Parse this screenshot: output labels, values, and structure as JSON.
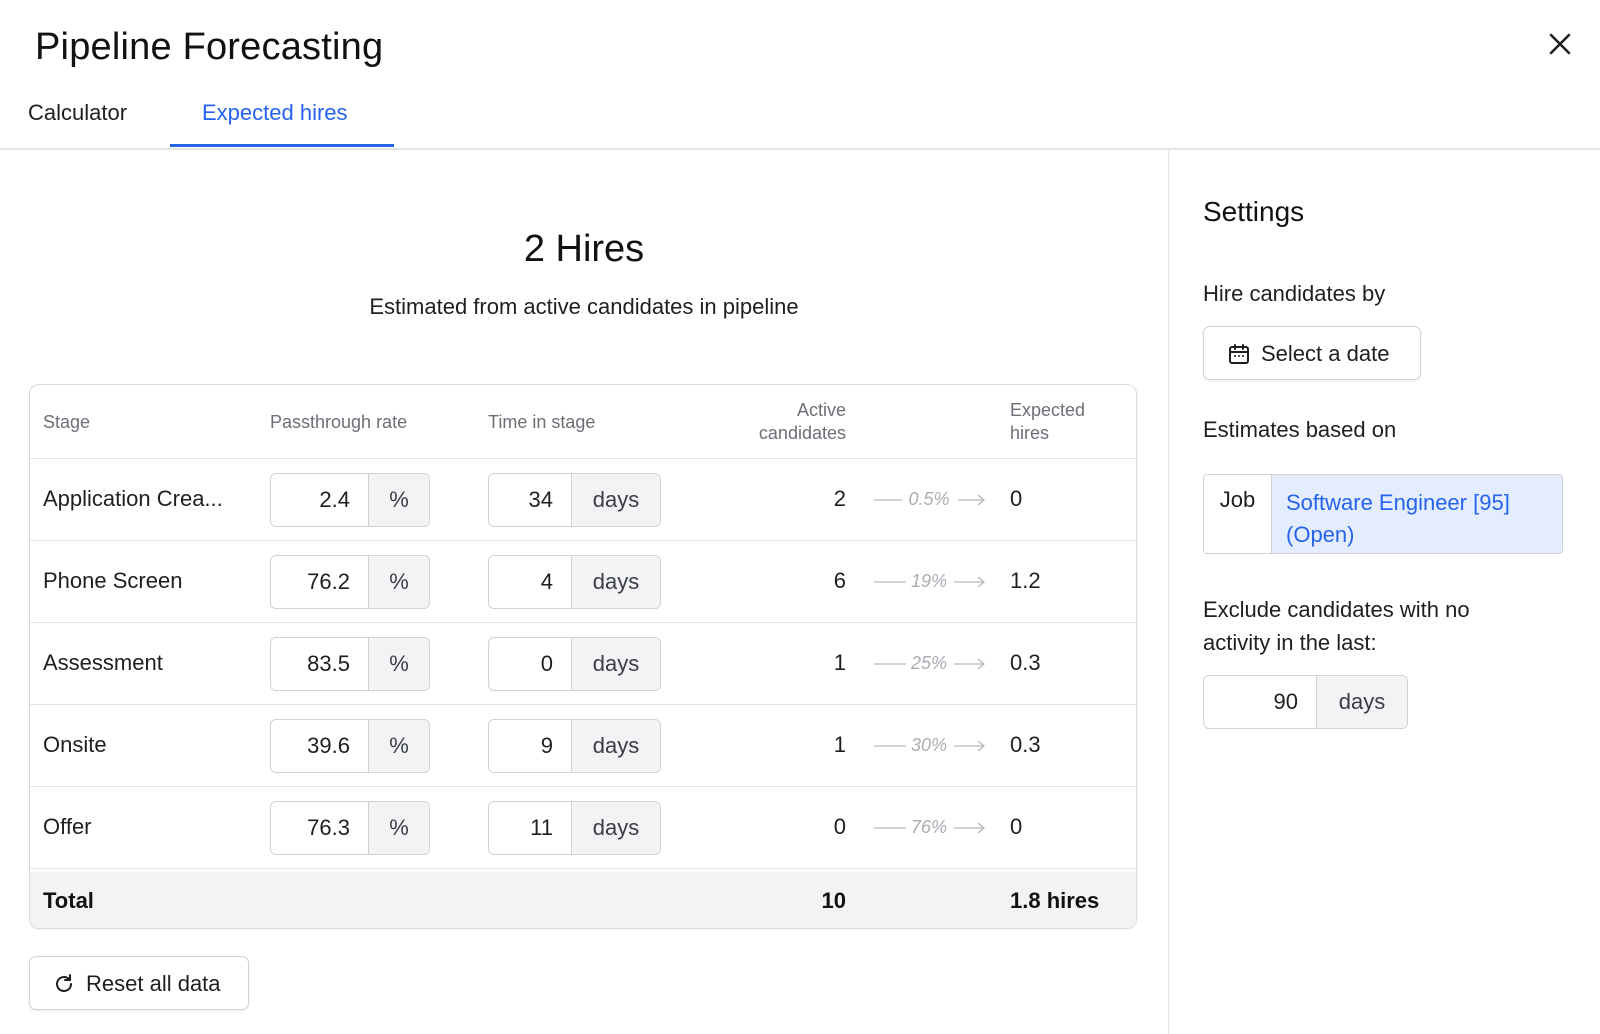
{
  "header": {
    "title": "Pipeline Forecasting",
    "tabs": [
      {
        "label": "Calculator",
        "active": false
      },
      {
        "label": "Expected hires",
        "active": true
      }
    ],
    "close_icon": "close-icon"
  },
  "summary": {
    "hires": "2 Hires",
    "subtitle": "Estimated from active candidates in pipeline"
  },
  "table": {
    "columns": {
      "stage": "Stage",
      "passthrough": "Passthrough rate",
      "time": "Time in stage",
      "active_line1": "Active",
      "active_line2": "candidates",
      "expected_line1": "Expected",
      "expected_line2": "hires"
    },
    "rows": [
      {
        "stage": "Application Crea...",
        "rate": "2.4",
        "rate_unit": "%",
        "time": "34",
        "time_unit": "days",
        "active": "2",
        "conversion": "0.5%",
        "expected": "0"
      },
      {
        "stage": "Phone Screen",
        "rate": "76.2",
        "rate_unit": "%",
        "time": "4",
        "time_unit": "days",
        "active": "6",
        "conversion": "19%",
        "expected": "1.2"
      },
      {
        "stage": "Assessment",
        "rate": "83.5",
        "rate_unit": "%",
        "time": "0",
        "time_unit": "days",
        "active": "1",
        "conversion": "25%",
        "expected": "0.3"
      },
      {
        "stage": "Onsite",
        "rate": "39.6",
        "rate_unit": "%",
        "time": "9",
        "time_unit": "days",
        "active": "1",
        "conversion": "30%",
        "expected": "0.3"
      },
      {
        "stage": "Offer",
        "rate": "76.3",
        "rate_unit": "%",
        "time": "11",
        "time_unit": "days",
        "active": "0",
        "conversion": "76%",
        "expected": "0"
      }
    ],
    "total": {
      "label": "Total",
      "active": "10",
      "expected": "1.8 hires"
    }
  },
  "reset": {
    "label": "Reset all data",
    "icon": "refresh-icon"
  },
  "settings": {
    "title": "Settings",
    "hire_by_label": "Hire candidates by",
    "date_button": "Select a date",
    "date_icon": "calendar-icon",
    "estimates_label": "Estimates based on",
    "job_key": "Job",
    "job_value": "Software Engineer [95] (Open)",
    "exclude_label_line1": "Exclude candidates with no",
    "exclude_label_line2": "activity in the last:",
    "exclude_days": "90",
    "exclude_unit": "days"
  },
  "colors": {
    "accent": "#2563eb",
    "job_bg": "#e4edfd",
    "suffix_bg": "#f2f3f5",
    "border": "#d0d2d6"
  }
}
